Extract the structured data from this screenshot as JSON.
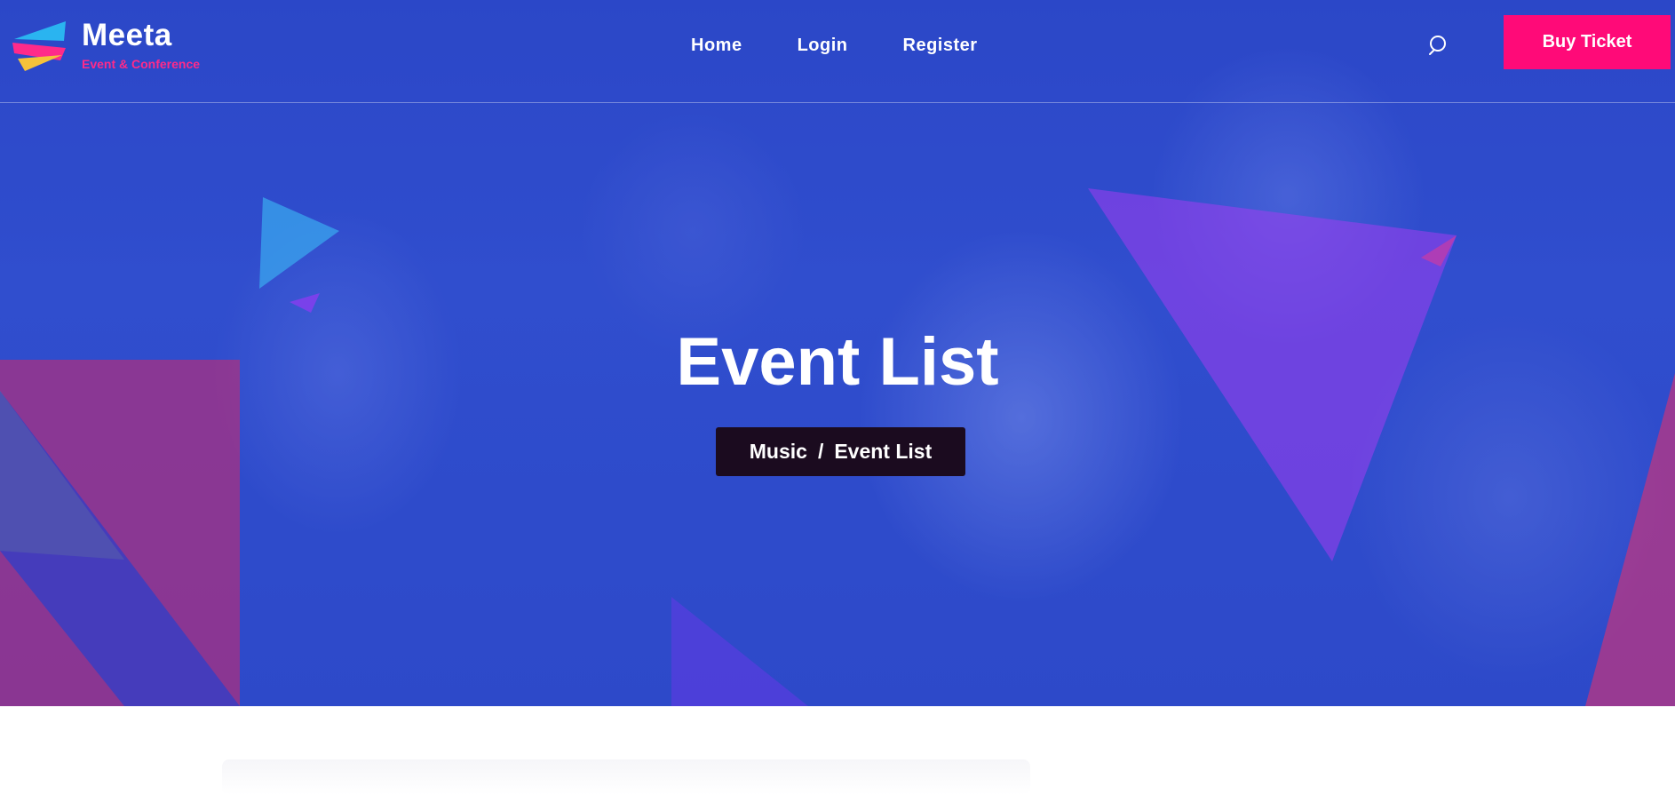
{
  "brand": {
    "name": "Meeta",
    "tagline": "Event & Conference"
  },
  "nav": {
    "items": [
      {
        "label": "Home"
      },
      {
        "label": "Login"
      },
      {
        "label": "Register"
      }
    ],
    "search_icon": "search-icon"
  },
  "cta": {
    "buy_ticket_label": "Buy Ticket"
  },
  "hero": {
    "title": "Event List",
    "breadcrumb": {
      "parent": "Music",
      "separator": "/",
      "current": "Event List"
    }
  },
  "colors": {
    "overlay_blue": "#3350cc",
    "accent_pink": "#ff0a78",
    "tagline_pink": "#ff2a8a",
    "breadcrumb_bg": "#1b0b1f",
    "logo_cyan": "#2ab4f0",
    "logo_pink": "#ff2a8a",
    "logo_yellow": "#f5c23a"
  }
}
